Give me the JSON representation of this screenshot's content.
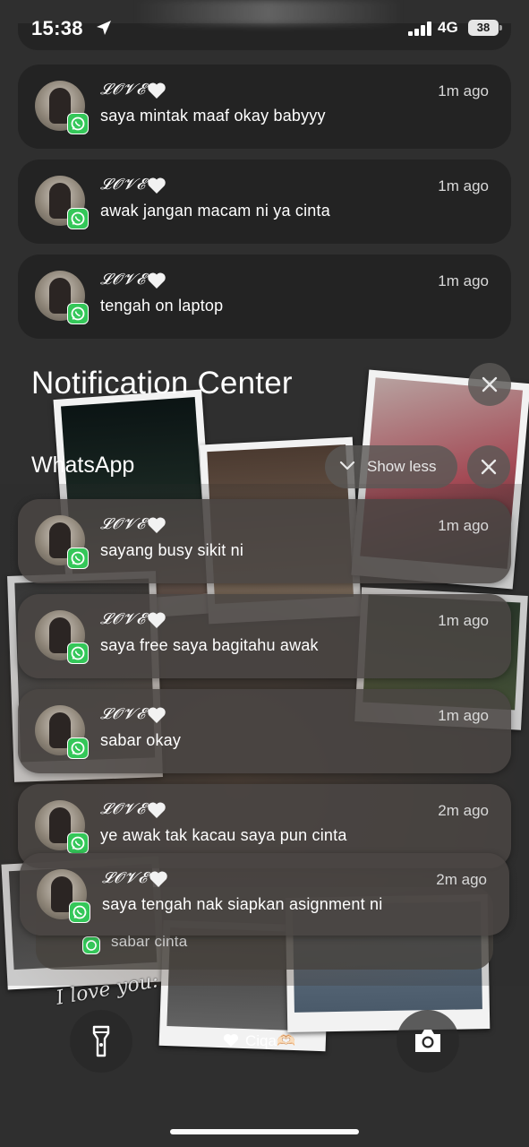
{
  "status_bar": {
    "time": "15:38",
    "network": "4G",
    "battery": "38"
  },
  "notification_center": {
    "title": "Notification Center",
    "group_title": "WhatsApp",
    "show_less_label": "Show less"
  },
  "recent_notifications": [
    {
      "sender": "𝓛𝓞𝓥𝓔",
      "time": "1m ago",
      "message": "saya mintak maaf okay babyyy"
    },
    {
      "sender": "𝓛𝓞𝓥𝓔",
      "time": "1m ago",
      "message": "awak jangan macam ni ya cinta"
    },
    {
      "sender": "𝓛𝓞𝓥𝓔",
      "time": "1m ago",
      "message": "tengah on laptop"
    }
  ],
  "whatsapp_notifications": [
    {
      "sender": "𝓛𝓞𝓥𝓔",
      "time": "1m ago",
      "message": "sayang busy sikit ni"
    },
    {
      "sender": "𝓛𝓞𝓥𝓔",
      "time": "1m ago",
      "message": "saya free saya bagitahu awak"
    },
    {
      "sender": "𝓛𝓞𝓥𝓔",
      "time": "1m ago",
      "message": "sabar okay"
    },
    {
      "sender": "𝓛𝓞𝓥𝓔",
      "time": "2m ago",
      "message": "ye awak tak kacau saya pun cinta"
    },
    {
      "sender": "𝓛𝓞𝓥𝓔",
      "time": "2m ago",
      "message": "saya tengah nak siapkan asignment ni"
    }
  ],
  "stacked_notification": {
    "message": "sabar cinta"
  },
  "lock_screen": {
    "owner_label": "Ciqa🫶🏻",
    "wallpaper_text": "I love you:"
  },
  "colors": {
    "whatsapp_green": "#34c759",
    "card_dark": "#232323"
  }
}
